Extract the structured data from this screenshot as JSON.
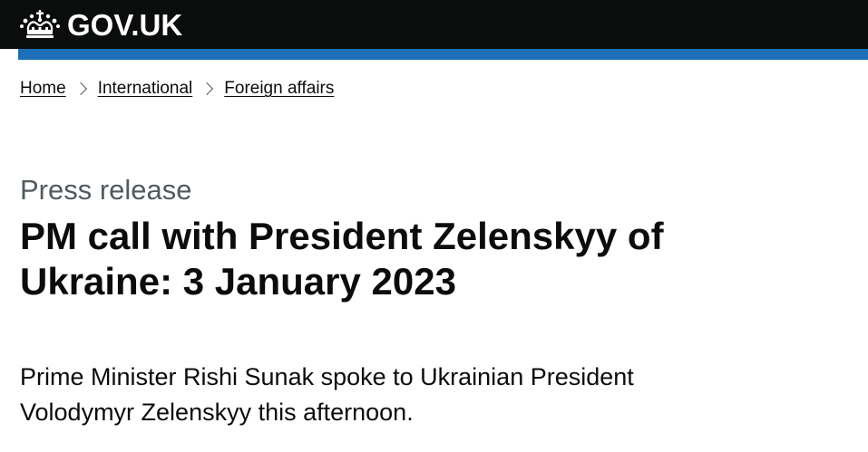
{
  "header": {
    "logo_text": "GOV.UK"
  },
  "breadcrumb": [
    {
      "label": "Home"
    },
    {
      "label": "International"
    },
    {
      "label": "Foreign affairs"
    }
  ],
  "page": {
    "caption": "Press release",
    "title": "PM call with President Zelenskyy of Ukraine: 3 January 2023",
    "lede": "Prime Minister Rishi Sunak spoke to Ukrainian President Volodymyr Zelenskyy this afternoon."
  },
  "icons": {
    "logo": "crown-icon",
    "separator": "chevron-right-icon"
  },
  "colors": {
    "header_bg": "#0b0c0c",
    "accent_bar": "#1d70b8",
    "text": "#0b0c0c",
    "secondary_text": "#505a5f"
  }
}
